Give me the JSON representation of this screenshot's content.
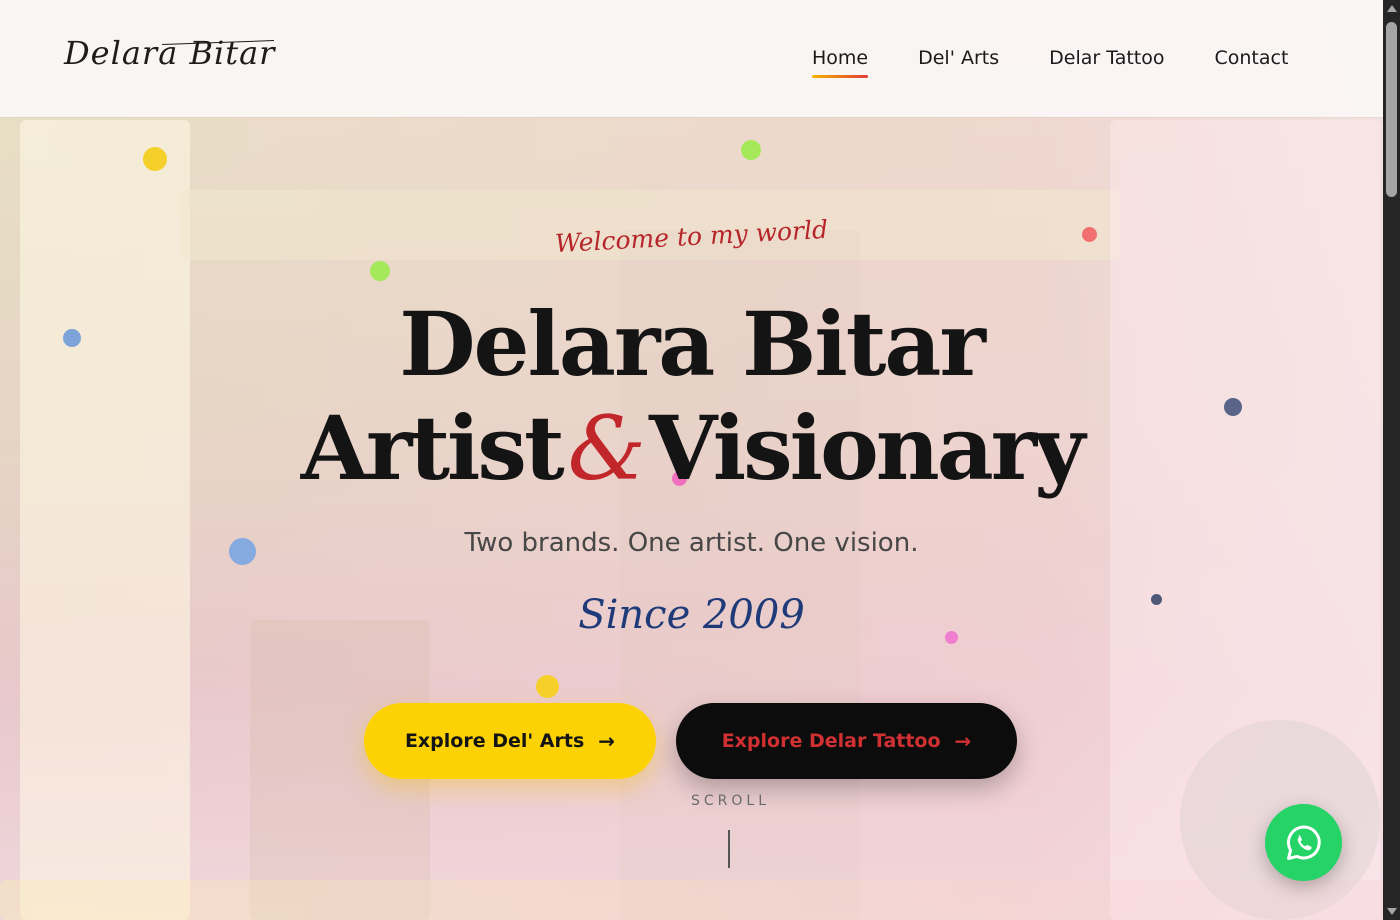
{
  "brand": {
    "logo_text": "Delara Bitar"
  },
  "nav": {
    "items": [
      {
        "label": "Home",
        "active": true
      },
      {
        "label": "Del' Arts",
        "active": false
      },
      {
        "label": "Delar Tattoo",
        "active": false
      },
      {
        "label": "Contact",
        "active": false
      }
    ]
  },
  "hero": {
    "welcome": "Welcome to my world",
    "title_name": "Delara",
    "title_name_rest": "Bitar",
    "title_line2_a": "Artist",
    "title_amp": "&",
    "title_line2_b": "Visionary",
    "tagline": "Two brands. One artist. One vision.",
    "since": "Since 2009",
    "buttons": {
      "primary": {
        "label": "Explore Del' Arts",
        "icon": "arrow-right-icon"
      },
      "secondary": {
        "label": "Explore Delar Tattoo",
        "icon": "arrow-right-icon"
      }
    },
    "scroll_label": "SCROLL"
  },
  "floating": {
    "whatsapp_icon": "whatsapp-icon"
  },
  "colors": {
    "accent_yellow": "#fcd204",
    "accent_red": "#c0262a",
    "navy": "#1f3a78",
    "dark": "#141414",
    "whatsapp_green": "#25d366"
  }
}
